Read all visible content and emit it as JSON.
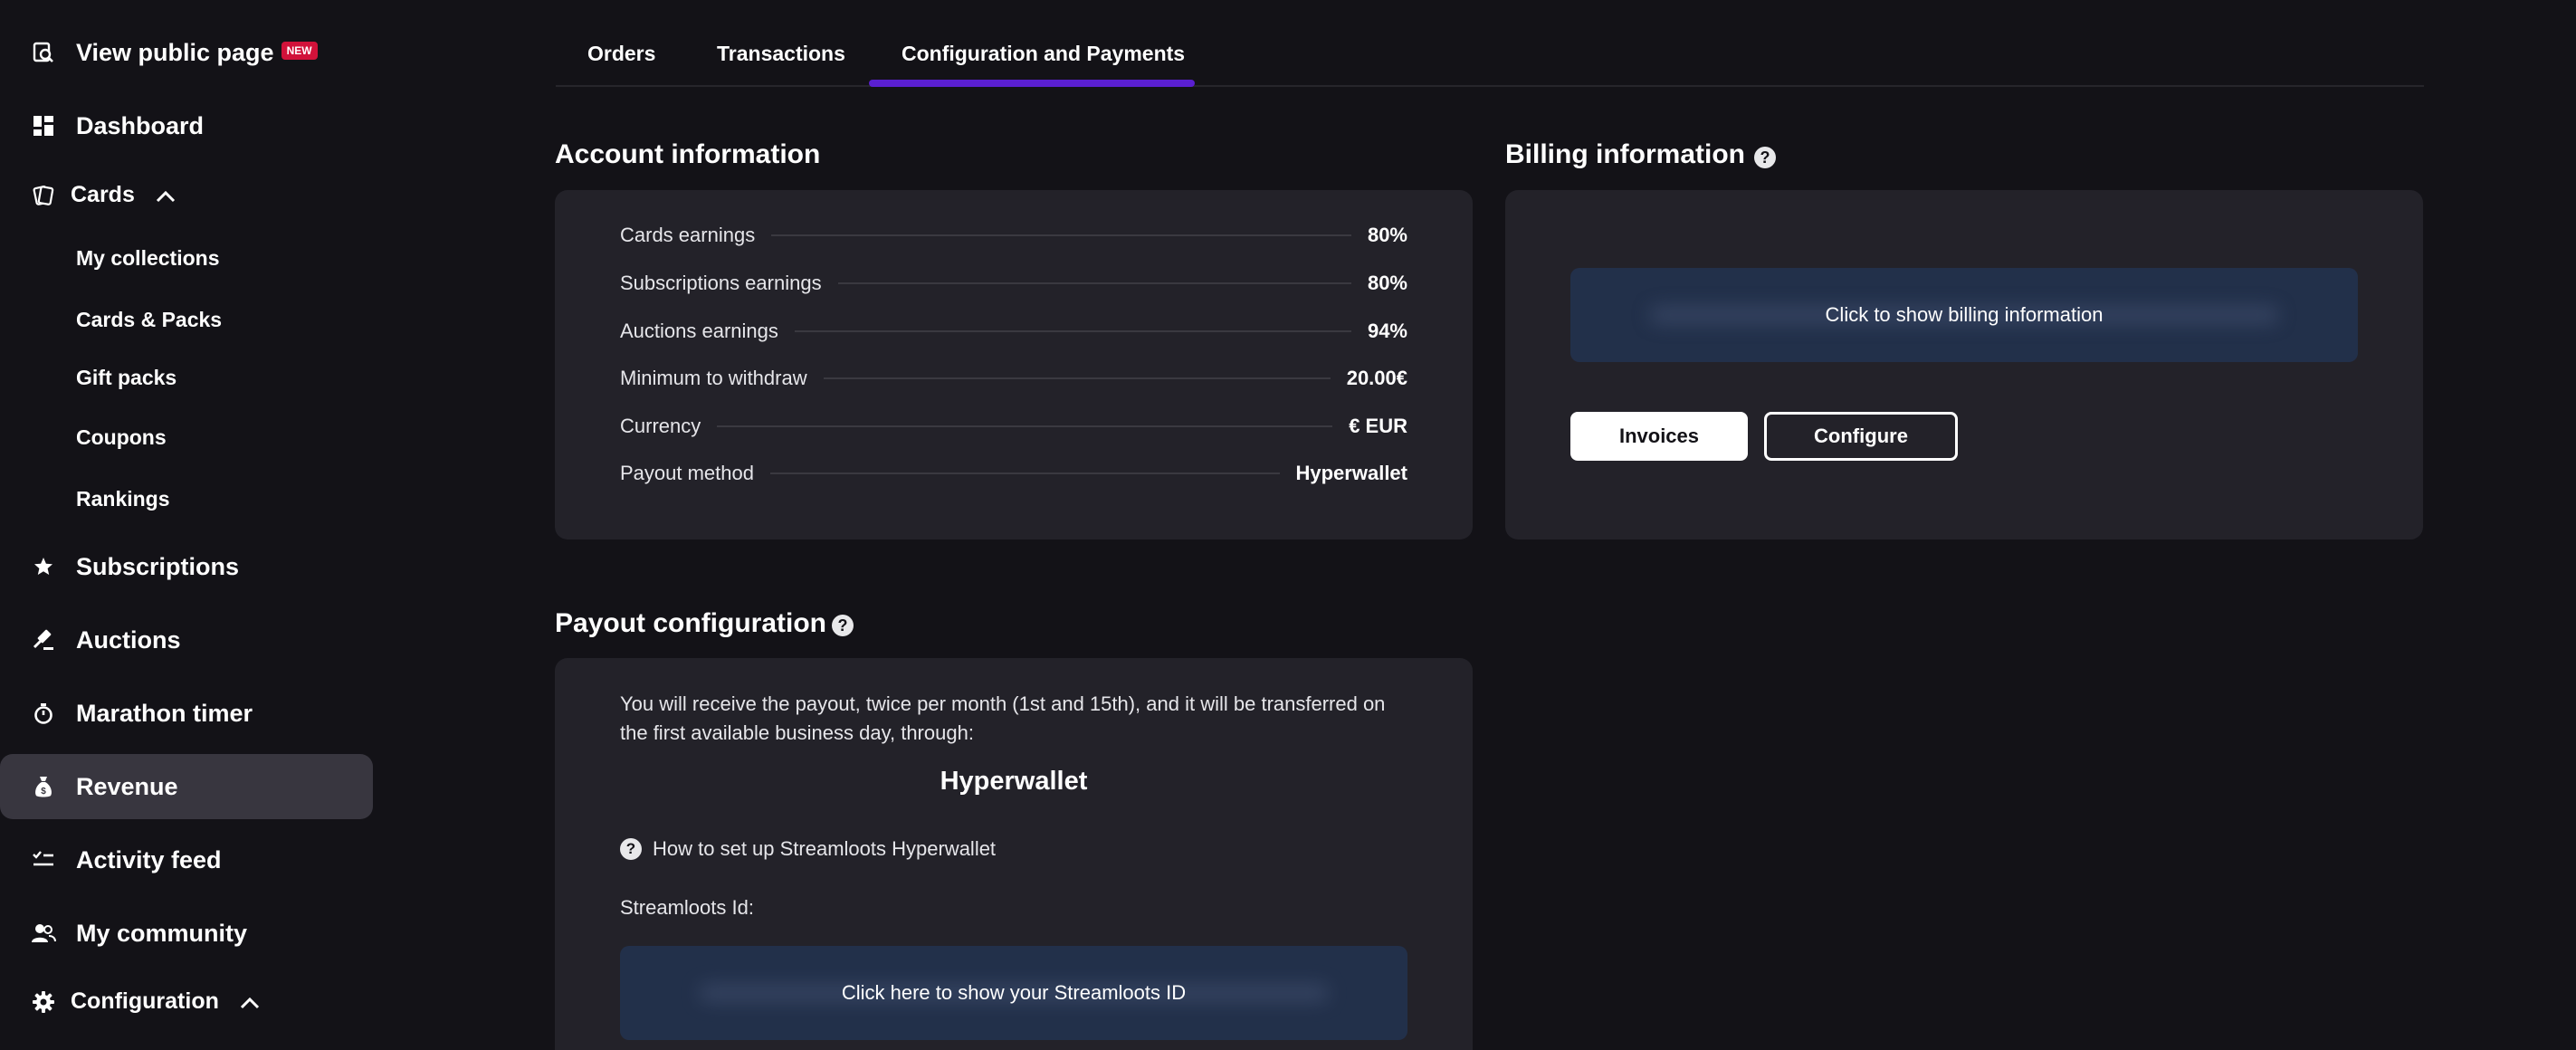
{
  "sidebar": {
    "view_public": {
      "label": "View public page",
      "badge": "NEW"
    },
    "dashboard": "Dashboard",
    "cards": "Cards",
    "cards_sub": [
      "My collections",
      "Cards & Packs",
      "Gift packs",
      "Coupons",
      "Rankings"
    ],
    "subscriptions": "Subscriptions",
    "auctions": "Auctions",
    "marathon": "Marathon timer",
    "revenue": "Revenue",
    "activity": "Activity feed",
    "community": "My community",
    "configuration": "Configuration"
  },
  "tabs": [
    "Orders",
    "Transactions",
    "Configuration and Payments"
  ],
  "account": {
    "title": "Account information",
    "rows": [
      {
        "label": "Cards earnings",
        "value": "80%"
      },
      {
        "label": "Subscriptions earnings",
        "value": "80%"
      },
      {
        "label": "Auctions earnings",
        "value": "94%"
      },
      {
        "label": "Minimum to withdraw",
        "value": "20.00€"
      },
      {
        "label": "Currency",
        "value": "€ EUR"
      },
      {
        "label": "Payout method",
        "value": "Hyperwallet"
      }
    ]
  },
  "billing": {
    "title": "Billing information",
    "help": "?",
    "reveal": "Click to show billing information",
    "invoices": "Invoices",
    "configure": "Configure"
  },
  "payout": {
    "title": "Payout configuration",
    "help": "?",
    "description": "You will receive the payout, twice per month (1st and 15th), and it will be transferred on the first available business day, through:",
    "method": "Hyperwallet",
    "howto_icon": "?",
    "howto": "How to set up Streamloots Hyperwallet",
    "id_label": "Streamloots Id:",
    "reveal": "Click here to show your Streamloots ID"
  }
}
